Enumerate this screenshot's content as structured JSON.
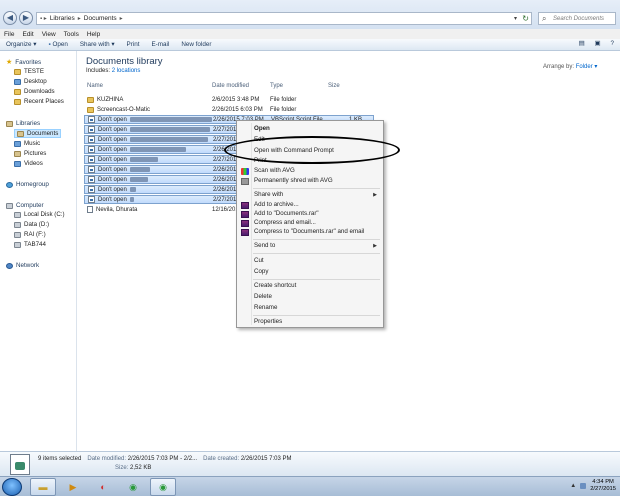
{
  "address": {
    "crumbs": [
      "Libraries",
      "Documents"
    ],
    "search_placeholder": "Search Documents"
  },
  "menu": [
    "File",
    "Edit",
    "View",
    "Tools",
    "Help"
  ],
  "toolbar": {
    "organize": "Organize ▾",
    "open": "Open",
    "share": "Share with ▾",
    "print": "Print",
    "email": "E-mail",
    "new_folder": "New folder"
  },
  "nav": {
    "favorites": "Favorites",
    "fav_items": [
      "TESTE",
      "Desktop",
      "Downloads",
      "Recent Places"
    ],
    "libraries": "Libraries",
    "lib_items": [
      "Documents",
      "Music",
      "Pictures",
      "Videos"
    ],
    "homegroup": "Homegroup",
    "computer": "Computer",
    "drives": [
      "Local Disk (C:)",
      "Data (D:)",
      "RAI (F:)",
      "TAB744"
    ],
    "network": "Network"
  },
  "library": {
    "title": "Documents library",
    "includes_prefix": "Includes:",
    "includes_link": "2 locations",
    "arrange_label": "Arrange by:",
    "arrange_value": "Folder ▾"
  },
  "columns": {
    "name": "Name",
    "date": "Date modified",
    "type": "Type",
    "size": "Size"
  },
  "files": [
    {
      "name": "KUZHINA",
      "date": "2/6/2015 3:48 PM",
      "type": "File folder",
      "size": ""
    },
    {
      "name": "Screencast-O-Matic",
      "date": "2/26/2015 6:03 PM",
      "type": "File folder",
      "size": ""
    },
    {
      "name": "Don't open",
      "date": "2/26/2015 7:03 PM",
      "type": "VBScript Script File",
      "size": "1 KB"
    },
    {
      "name": "Don't open",
      "date": "2/27/2015",
      "type": "",
      "size": ""
    },
    {
      "name": "Don't open",
      "date": "2/27/2015",
      "type": "",
      "size": ""
    },
    {
      "name": "Don't open",
      "date": "2/26/2015",
      "type": "",
      "size": ""
    },
    {
      "name": "Don't open",
      "date": "2/27/2015",
      "type": "",
      "size": ""
    },
    {
      "name": "Don't open",
      "date": "2/26/2015",
      "type": "",
      "size": ""
    },
    {
      "name": "Don't open",
      "date": "2/26/2015",
      "type": "",
      "size": ""
    },
    {
      "name": "Don't open",
      "date": "2/26/2015",
      "type": "",
      "size": ""
    },
    {
      "name": "Don't open",
      "date": "2/27/2015",
      "type": "",
      "size": ""
    },
    {
      "name": "Nevila, Dhurata",
      "date": "12/16/2014",
      "type": "",
      "size": ""
    }
  ],
  "context_menu": {
    "open": "Open",
    "edit": "Edit",
    "open_cmd": "Open with Command Prompt",
    "print": "Print",
    "scan_avg": "Scan with AVG",
    "shred_avg": "Permanently shred with AVG",
    "share_with": "Share with",
    "add_archive": "Add to archive...",
    "add_rar": "Add to \"Documents.rar\"",
    "compress_email": "Compress and email...",
    "compress_rar_email": "Compress to \"Documents.rar\" and email",
    "send_to": "Send to",
    "cut": "Cut",
    "copy": "Copy",
    "create_shortcut": "Create shortcut",
    "delete": "Delete",
    "rename": "Rename",
    "properties": "Properties"
  },
  "details": {
    "selected": "9 items selected",
    "date_modified_label": "Date modified:",
    "date_modified": "2/26/2015 7:03 PM - 2/2...",
    "date_created_label": "Date created:",
    "date_created": "2/26/2015 7:03 PM",
    "size_label": "Size:",
    "size": "2,52 KB"
  },
  "clock": {
    "time": "4:34 PM",
    "date": "2/27/2015"
  }
}
